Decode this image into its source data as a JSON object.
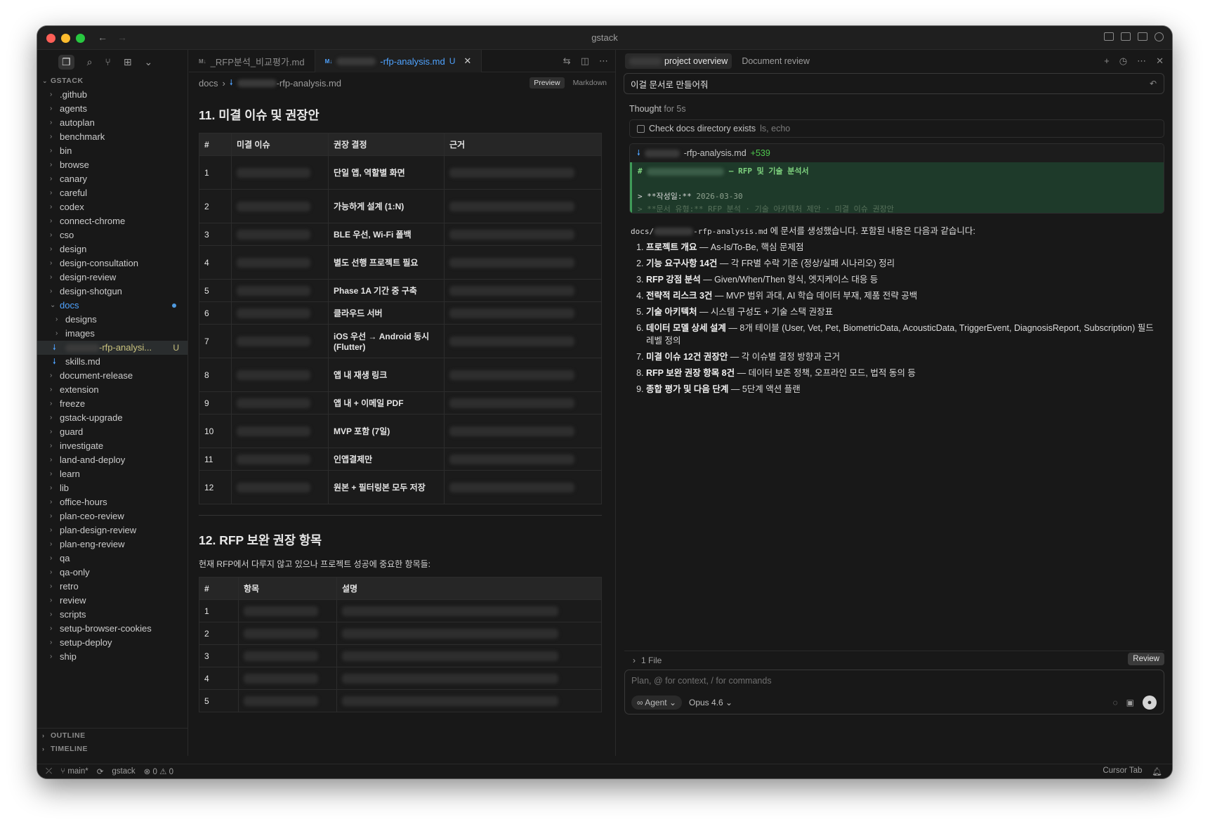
{
  "window": {
    "title": "gstack"
  },
  "sidebar": {
    "section_title": "GSTACK",
    "items": [
      {
        "label": ".github"
      },
      {
        "label": "agents"
      },
      {
        "label": "autoplan"
      },
      {
        "label": "benchmark"
      },
      {
        "label": "bin"
      },
      {
        "label": "browse"
      },
      {
        "label": "canary"
      },
      {
        "label": "careful"
      },
      {
        "label": "codex"
      },
      {
        "label": "connect-chrome"
      },
      {
        "label": "cso"
      },
      {
        "label": "design"
      },
      {
        "label": "design-consultation"
      },
      {
        "label": "design-review"
      },
      {
        "label": "design-shotgun"
      }
    ],
    "docs_folder": "docs",
    "docs_children": [
      {
        "label": "designs"
      },
      {
        "label": "images"
      }
    ],
    "active_file": {
      "label": "-rfp-analysi...",
      "badge": "U"
    },
    "skills_file": "skills.md",
    "items_after": [
      {
        "label": "document-release"
      },
      {
        "label": "extension"
      },
      {
        "label": "freeze"
      },
      {
        "label": "gstack-upgrade"
      },
      {
        "label": "guard"
      },
      {
        "label": "investigate"
      },
      {
        "label": "land-and-deploy"
      },
      {
        "label": "learn"
      },
      {
        "label": "lib"
      },
      {
        "label": "office-hours"
      },
      {
        "label": "plan-ceo-review"
      },
      {
        "label": "plan-design-review"
      },
      {
        "label": "plan-eng-review"
      },
      {
        "label": "qa"
      },
      {
        "label": "qa-only"
      },
      {
        "label": "retro"
      },
      {
        "label": "review"
      },
      {
        "label": "scripts"
      },
      {
        "label": "setup-browser-cookies"
      },
      {
        "label": "setup-deploy"
      },
      {
        "label": "ship"
      }
    ],
    "outline_title": "OUTLINE",
    "timeline_title": "TIMELINE"
  },
  "editor": {
    "tab1": {
      "icon": "M↓",
      "label": "_RFP분석_비교평가.md"
    },
    "tab2": {
      "icon": "M↓",
      "label": "-rfp-analysis.md",
      "badge": "U"
    },
    "breadcrumb": {
      "folder": "docs",
      "file": "-rfp-analysis.md"
    },
    "mode_preview": "Preview",
    "mode_markdown": "Markdown",
    "section11": {
      "title": "11. 미결 이슈 및 권장안",
      "headers": [
        "#",
        "미결 이슈",
        "권장 결정",
        "근거"
      ],
      "rows": [
        {
          "num": "1",
          "decision": "단일 앱, 역할별 화면"
        },
        {
          "num": "2",
          "decision": "가능하게 설계 (1:N)"
        },
        {
          "num": "3",
          "decision": "BLE 우선, Wi-Fi 폴백"
        },
        {
          "num": "4",
          "decision": "별도 선행 프로젝트 필요"
        },
        {
          "num": "5",
          "decision": "Phase 1A 기간 중 구축"
        },
        {
          "num": "6",
          "decision": "클라우드 서버"
        },
        {
          "num": "7",
          "decision": "iOS 우선 → Android 동시 (Flutter)"
        },
        {
          "num": "8",
          "decision": "앱 내 재생 링크"
        },
        {
          "num": "9",
          "decision": "앱 내 + 이메일 PDF"
        },
        {
          "num": "10",
          "decision": "MVP 포함 (7일)"
        },
        {
          "num": "11",
          "decision": "인앱결제만"
        },
        {
          "num": "12",
          "decision": "원본 + 필터링본 모두 저장"
        }
      ]
    },
    "section12": {
      "title": "12. RFP 보완 권장 항목",
      "lead": "현재 RFP에서 다루지 않고 있으나 프로젝트 성공에 중요한 항목들:",
      "headers": [
        "#",
        "항목",
        "설명"
      ],
      "rows": [
        {
          "num": "1"
        },
        {
          "num": "2"
        },
        {
          "num": "3"
        },
        {
          "num": "4"
        },
        {
          "num": "5"
        }
      ]
    }
  },
  "chat": {
    "tab_active": "project overview",
    "tab_other": "Document review",
    "user_prompt": "이걸 문서로 만들어줘",
    "thought_label": "Thought",
    "thought_time": "for 5s",
    "tool_label": "Check docs directory exists",
    "tool_cmds": "ls, echo",
    "diff": {
      "file": "-rfp-analysis.md",
      "added": "+539",
      "line1": "— RFP 및 기술 분석서",
      "line2_label": "> **작성일:**",
      "line2_value": "2026-03-30",
      "line3": "> **문서 유형:** RFP 분석 · 기술 아키텍처 제안 · 미결 이슈 권장안"
    },
    "answer_prefix": "docs/",
    "answer_file": "-rfp-analysis.md",
    "answer_suffix": "에 문서를 생성했습니다. 포함된 내용은 다음과 같습니다:",
    "list": [
      {
        "bold": "프로젝트 개요",
        "text": " — As-Is/To-Be, 핵심 문제점"
      },
      {
        "bold": "기능 요구사항 14건",
        "text": " — 각 FR별 수락 기준 (정상/실패 시나리오) 정리"
      },
      {
        "bold": "RFP 강점 분석",
        "text": " — Given/When/Then 형식, 엣지케이스 대응 등"
      },
      {
        "bold": "전략적 리스크 3건",
        "text": " — MVP 범위 과대, AI 학습 데이터 부재, 제품 전략 공백"
      },
      {
        "bold": "기술 아키텍처",
        "text": " — 시스템 구성도 + 기술 스택 권장표"
      },
      {
        "bold": "데이터 모델 상세 설계",
        "text": " — 8개 테이블 (User, Vet, Pet, BiometricData, AcousticData, TriggerEvent, DiagnosisReport, Subscription) 필드 레벨 정의"
      },
      {
        "bold": "미결 이슈 12건 권장안",
        "text": " — 각 이슈별 결정 방향과 근거"
      },
      {
        "bold": "RFP 보완 권장 항목 8건",
        "text": " — 데이터 보존 정책, 오프라인 모드, 법적 동의 등"
      },
      {
        "bold": "종합 평가 및 다음 단계",
        "text": " — 5단계 액션 플랜"
      }
    ],
    "files_label": "1 File",
    "review_button": "Review",
    "composer_placeholder": "Plan, @ for context, / for commands",
    "agent_label": "Agent",
    "model_label": "Opus 4.6"
  },
  "statusbar": {
    "branch": "main*",
    "project": "gstack",
    "errors": "0",
    "warnings": "0",
    "cursor_tab": "Cursor Tab"
  }
}
